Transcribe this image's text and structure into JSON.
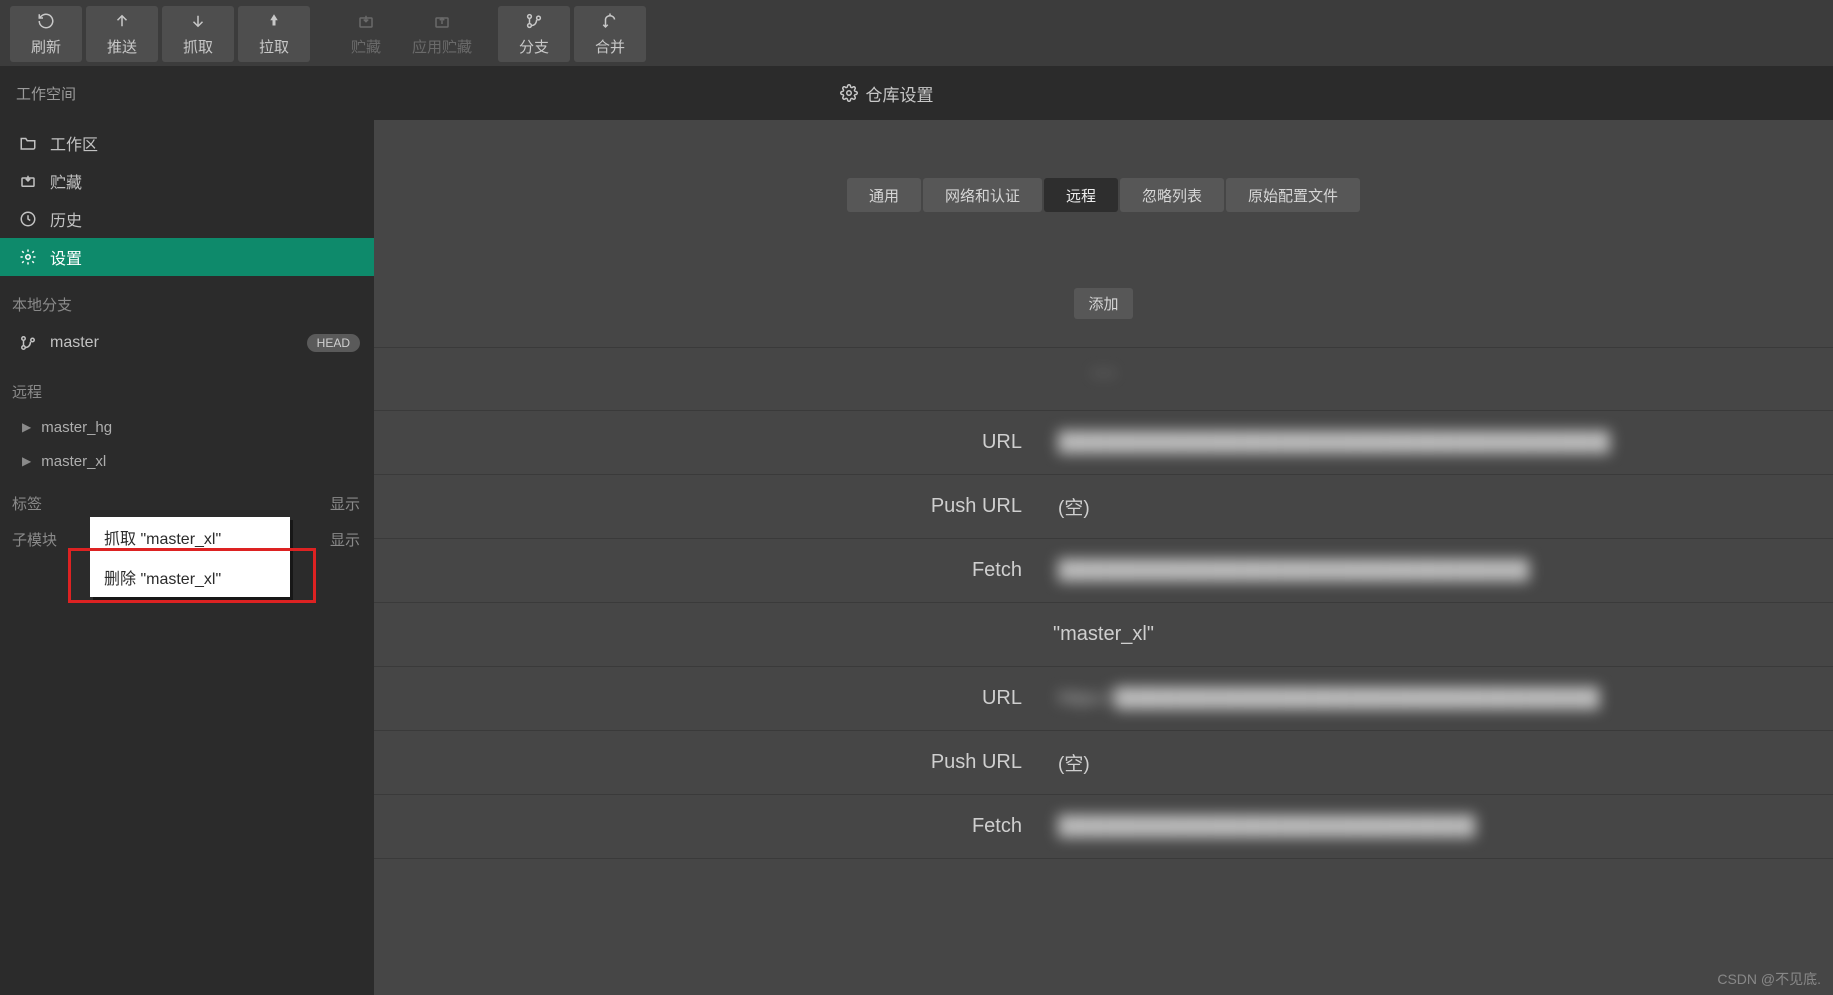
{
  "toolbar": {
    "refresh": "刷新",
    "push": "推送",
    "fetch": "抓取",
    "pull": "拉取",
    "stash": "贮藏",
    "apply_stash": "应用贮藏",
    "branch": "分支",
    "merge": "合并"
  },
  "workspace": {
    "title": "工作空间",
    "repo_settings_label": "仓库设置"
  },
  "sidebar": {
    "workspace_items": [
      {
        "label": "工作区"
      },
      {
        "label": "贮藏"
      },
      {
        "label": "历史"
      },
      {
        "label": "设置"
      }
    ],
    "local_branches_label": "本地分支",
    "branch_name": "master",
    "head_badge": "HEAD",
    "remotes_label": "远程",
    "remotes": [
      {
        "label": "master_hg"
      },
      {
        "label": "master_xl"
      }
    ],
    "tags_label": "标签",
    "submodules_label": "子模块",
    "show_label": "显示"
  },
  "context_menu": {
    "fetch": "抓取 \"master_xl\"",
    "delete": "删除 \"master_xl\""
  },
  "tabs": {
    "general": "通用",
    "network": "网络和认证",
    "remote": "远程",
    "ignore": "忽略列表",
    "raw": "原始配置文件"
  },
  "add_button": "添加",
  "remote_detail": {
    "section1_name_quoted": "\"              \"",
    "section2_name_quoted": "\"master_xl\"",
    "url_label": "URL",
    "push_url_label": "Push URL",
    "fetch_label": "Fetch",
    "empty_value": "(空)",
    "redacted_url_1": "█████████████████████████████████████████",
    "redacted_fetch_1": "███████████████████████████████████",
    "redacted_url_2": "https://████████████████████████████████████",
    "redacted_fetch_2": "███████████████████████████████"
  },
  "watermark": "CSDN @不见底."
}
